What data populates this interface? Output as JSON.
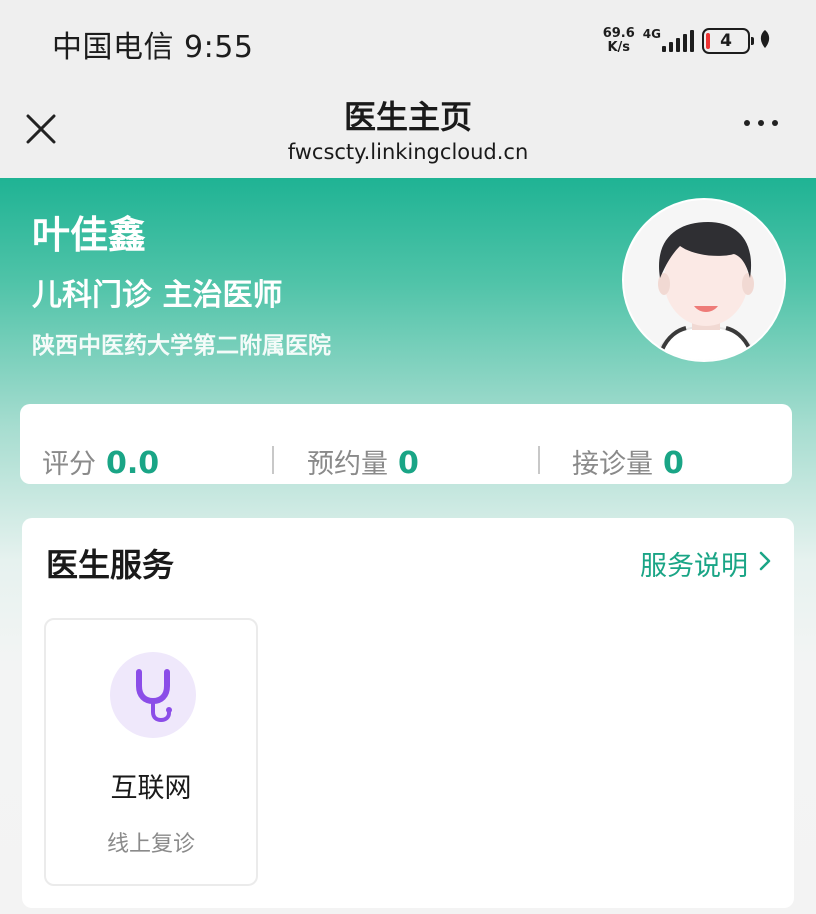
{
  "status_bar": {
    "carrier_time": "中国电信 9:55",
    "net_speed_value": "69.6",
    "net_speed_unit": "K/s",
    "network_type": "4G",
    "battery_level": "4"
  },
  "title_bar": {
    "title": "医生主页",
    "url": "fwcscty.linkingcloud.cn"
  },
  "doctor": {
    "name": "叶佳鑫",
    "department_title": "儿科门诊 主治医师",
    "hospital": "陕西中医药大学第二附属医院"
  },
  "stats": [
    {
      "label": "评分",
      "value": "0.0"
    },
    {
      "label": "预约量",
      "value": "0"
    },
    {
      "label": "接诊量",
      "value": "0"
    }
  ],
  "services": {
    "title": "医生服务",
    "link_label": "服务说明",
    "items": [
      {
        "name": "互联网",
        "description": "线上复诊",
        "icon": "stethoscope-icon"
      }
    ]
  },
  "colors": {
    "accent": "#1aa586",
    "header_green": "#1fb394",
    "service_icon_bg": "#efe8fb",
    "service_icon": "#8b4de8"
  }
}
